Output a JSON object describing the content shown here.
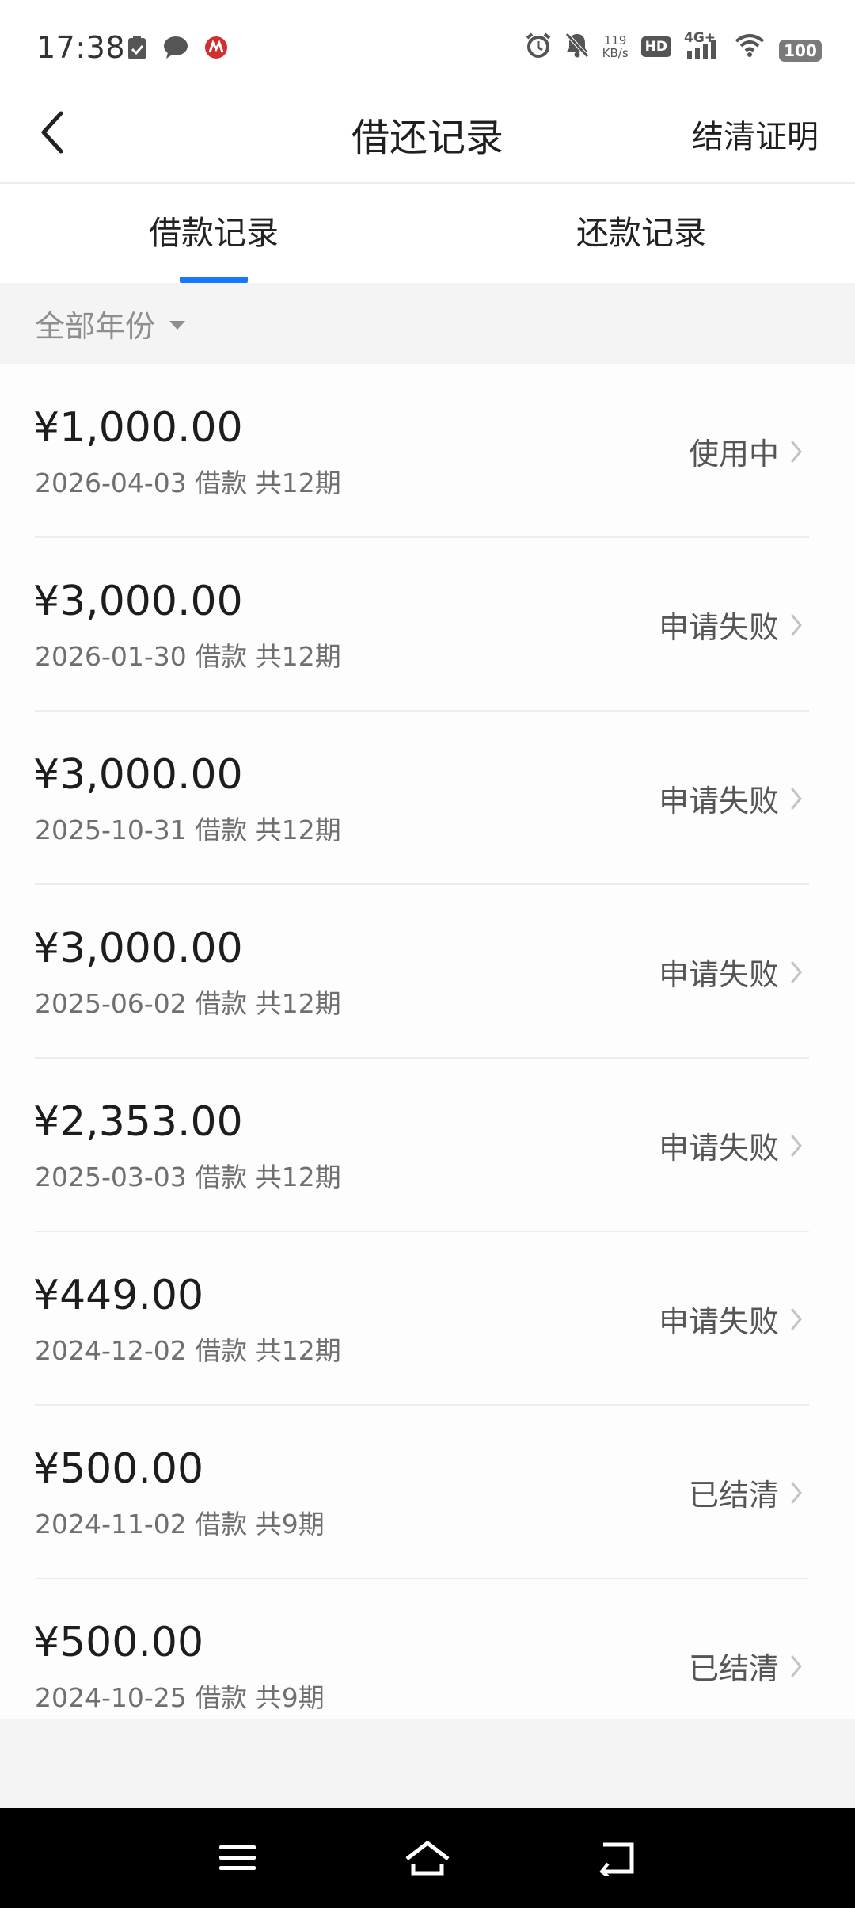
{
  "status_bar": {
    "time": "17:38",
    "net_speed_value": "119",
    "net_speed_unit": "KB/s",
    "hd_label": "HD",
    "network_label": "4G+",
    "battery": "100"
  },
  "header": {
    "title": "借还记录",
    "right_action": "结清证明"
  },
  "tabs": [
    {
      "label": "借款记录",
      "active": true
    },
    {
      "label": "还款记录",
      "active": false
    }
  ],
  "filter": {
    "year_label": "全部年份"
  },
  "loans": [
    {
      "amount": "¥1,000.00",
      "meta": "2026-04-03 借款 共12期",
      "status": "使用中"
    },
    {
      "amount": "¥3,000.00",
      "meta": "2026-01-30 借款 共12期",
      "status": "申请失败"
    },
    {
      "amount": "¥3,000.00",
      "meta": "2025-10-31 借款 共12期",
      "status": "申请失败"
    },
    {
      "amount": "¥3,000.00",
      "meta": "2025-06-02 借款 共12期",
      "status": "申请失败"
    },
    {
      "amount": "¥2,353.00",
      "meta": "2025-03-03 借款 共12期",
      "status": "申请失败"
    },
    {
      "amount": "¥449.00",
      "meta": "2024-12-02 借款 共12期",
      "status": "申请失败"
    },
    {
      "amount": "¥500.00",
      "meta": "2024-11-02 借款 共9期",
      "status": "已结清"
    },
    {
      "amount": "¥500.00",
      "meta": "2024-10-25 借款 共9期",
      "status": "已结清"
    }
  ],
  "colors": {
    "accent": "#1677ff",
    "filter_bg": "#f4f4f4",
    "nav_bar": "#000000"
  }
}
